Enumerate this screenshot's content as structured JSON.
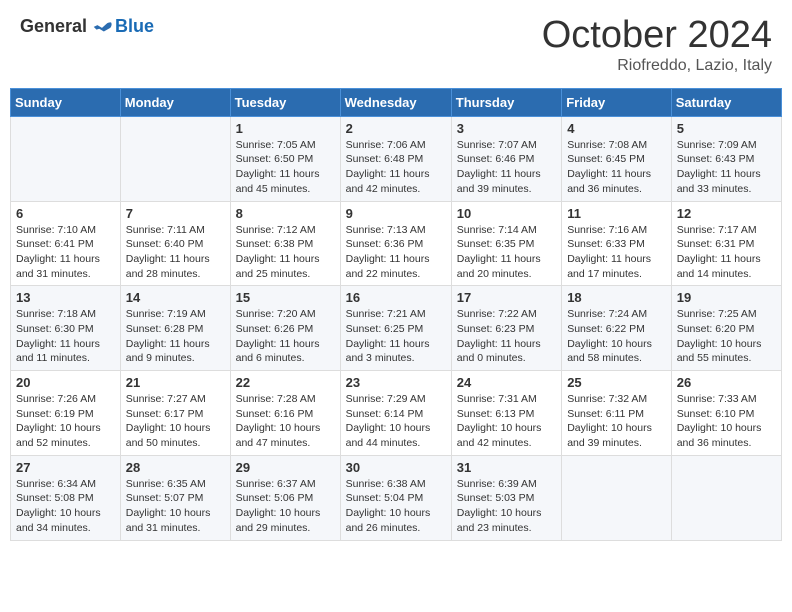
{
  "logo": {
    "general": "General",
    "blue": "Blue"
  },
  "title": "October 2024",
  "location": "Riofreddo, Lazio, Italy",
  "days_of_week": [
    "Sunday",
    "Monday",
    "Tuesday",
    "Wednesday",
    "Thursday",
    "Friday",
    "Saturday"
  ],
  "weeks": [
    [
      null,
      null,
      {
        "day": 1,
        "sunrise": "Sunrise: 7:05 AM",
        "sunset": "Sunset: 6:50 PM",
        "daylight": "Daylight: 11 hours and 45 minutes."
      },
      {
        "day": 2,
        "sunrise": "Sunrise: 7:06 AM",
        "sunset": "Sunset: 6:48 PM",
        "daylight": "Daylight: 11 hours and 42 minutes."
      },
      {
        "day": 3,
        "sunrise": "Sunrise: 7:07 AM",
        "sunset": "Sunset: 6:46 PM",
        "daylight": "Daylight: 11 hours and 39 minutes."
      },
      {
        "day": 4,
        "sunrise": "Sunrise: 7:08 AM",
        "sunset": "Sunset: 6:45 PM",
        "daylight": "Daylight: 11 hours and 36 minutes."
      },
      {
        "day": 5,
        "sunrise": "Sunrise: 7:09 AM",
        "sunset": "Sunset: 6:43 PM",
        "daylight": "Daylight: 11 hours and 33 minutes."
      }
    ],
    [
      {
        "day": 6,
        "sunrise": "Sunrise: 7:10 AM",
        "sunset": "Sunset: 6:41 PM",
        "daylight": "Daylight: 11 hours and 31 minutes."
      },
      {
        "day": 7,
        "sunrise": "Sunrise: 7:11 AM",
        "sunset": "Sunset: 6:40 PM",
        "daylight": "Daylight: 11 hours and 28 minutes."
      },
      {
        "day": 8,
        "sunrise": "Sunrise: 7:12 AM",
        "sunset": "Sunset: 6:38 PM",
        "daylight": "Daylight: 11 hours and 25 minutes."
      },
      {
        "day": 9,
        "sunrise": "Sunrise: 7:13 AM",
        "sunset": "Sunset: 6:36 PM",
        "daylight": "Daylight: 11 hours and 22 minutes."
      },
      {
        "day": 10,
        "sunrise": "Sunrise: 7:14 AM",
        "sunset": "Sunset: 6:35 PM",
        "daylight": "Daylight: 11 hours and 20 minutes."
      },
      {
        "day": 11,
        "sunrise": "Sunrise: 7:16 AM",
        "sunset": "Sunset: 6:33 PM",
        "daylight": "Daylight: 11 hours and 17 minutes."
      },
      {
        "day": 12,
        "sunrise": "Sunrise: 7:17 AM",
        "sunset": "Sunset: 6:31 PM",
        "daylight": "Daylight: 11 hours and 14 minutes."
      }
    ],
    [
      {
        "day": 13,
        "sunrise": "Sunrise: 7:18 AM",
        "sunset": "Sunset: 6:30 PM",
        "daylight": "Daylight: 11 hours and 11 minutes."
      },
      {
        "day": 14,
        "sunrise": "Sunrise: 7:19 AM",
        "sunset": "Sunset: 6:28 PM",
        "daylight": "Daylight: 11 hours and 9 minutes."
      },
      {
        "day": 15,
        "sunrise": "Sunrise: 7:20 AM",
        "sunset": "Sunset: 6:26 PM",
        "daylight": "Daylight: 11 hours and 6 minutes."
      },
      {
        "day": 16,
        "sunrise": "Sunrise: 7:21 AM",
        "sunset": "Sunset: 6:25 PM",
        "daylight": "Daylight: 11 hours and 3 minutes."
      },
      {
        "day": 17,
        "sunrise": "Sunrise: 7:22 AM",
        "sunset": "Sunset: 6:23 PM",
        "daylight": "Daylight: 11 hours and 0 minutes."
      },
      {
        "day": 18,
        "sunrise": "Sunrise: 7:24 AM",
        "sunset": "Sunset: 6:22 PM",
        "daylight": "Daylight: 10 hours and 58 minutes."
      },
      {
        "day": 19,
        "sunrise": "Sunrise: 7:25 AM",
        "sunset": "Sunset: 6:20 PM",
        "daylight": "Daylight: 10 hours and 55 minutes."
      }
    ],
    [
      {
        "day": 20,
        "sunrise": "Sunrise: 7:26 AM",
        "sunset": "Sunset: 6:19 PM",
        "daylight": "Daylight: 10 hours and 52 minutes."
      },
      {
        "day": 21,
        "sunrise": "Sunrise: 7:27 AM",
        "sunset": "Sunset: 6:17 PM",
        "daylight": "Daylight: 10 hours and 50 minutes."
      },
      {
        "day": 22,
        "sunrise": "Sunrise: 7:28 AM",
        "sunset": "Sunset: 6:16 PM",
        "daylight": "Daylight: 10 hours and 47 minutes."
      },
      {
        "day": 23,
        "sunrise": "Sunrise: 7:29 AM",
        "sunset": "Sunset: 6:14 PM",
        "daylight": "Daylight: 10 hours and 44 minutes."
      },
      {
        "day": 24,
        "sunrise": "Sunrise: 7:31 AM",
        "sunset": "Sunset: 6:13 PM",
        "daylight": "Daylight: 10 hours and 42 minutes."
      },
      {
        "day": 25,
        "sunrise": "Sunrise: 7:32 AM",
        "sunset": "Sunset: 6:11 PM",
        "daylight": "Daylight: 10 hours and 39 minutes."
      },
      {
        "day": 26,
        "sunrise": "Sunrise: 7:33 AM",
        "sunset": "Sunset: 6:10 PM",
        "daylight": "Daylight: 10 hours and 36 minutes."
      }
    ],
    [
      {
        "day": 27,
        "sunrise": "Sunrise: 6:34 AM",
        "sunset": "Sunset: 5:08 PM",
        "daylight": "Daylight: 10 hours and 34 minutes."
      },
      {
        "day": 28,
        "sunrise": "Sunrise: 6:35 AM",
        "sunset": "Sunset: 5:07 PM",
        "daylight": "Daylight: 10 hours and 31 minutes."
      },
      {
        "day": 29,
        "sunrise": "Sunrise: 6:37 AM",
        "sunset": "Sunset: 5:06 PM",
        "daylight": "Daylight: 10 hours and 29 minutes."
      },
      {
        "day": 30,
        "sunrise": "Sunrise: 6:38 AM",
        "sunset": "Sunset: 5:04 PM",
        "daylight": "Daylight: 10 hours and 26 minutes."
      },
      {
        "day": 31,
        "sunrise": "Sunrise: 6:39 AM",
        "sunset": "Sunset: 5:03 PM",
        "daylight": "Daylight: 10 hours and 23 minutes."
      },
      null,
      null
    ]
  ]
}
